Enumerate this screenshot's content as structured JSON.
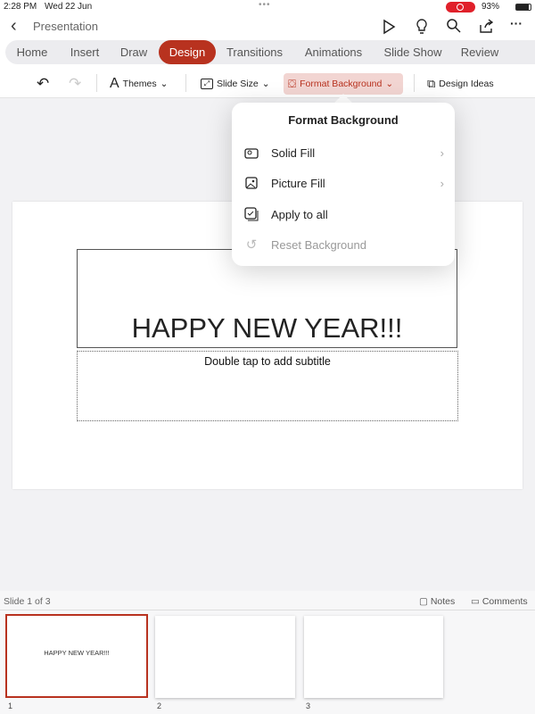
{
  "status": {
    "time": "2:28 PM",
    "date": "Wed 22 Jun",
    "battery": "93%",
    "record_color": "#e0202a"
  },
  "header": {
    "title": "Presentation"
  },
  "tabs": [
    {
      "label": "Home"
    },
    {
      "label": "Insert"
    },
    {
      "label": "Draw"
    },
    {
      "label": "Design",
      "active": true
    },
    {
      "label": "Transitions"
    },
    {
      "label": "Animations"
    },
    {
      "label": "Slide Show"
    },
    {
      "label": "Review"
    }
  ],
  "toolbar": {
    "themes": "Themes",
    "slide_size": "Slide Size",
    "format_background": "Format Background",
    "design_ideas": "Design Ideas"
  },
  "popup": {
    "title": "Format Background",
    "items": [
      {
        "label": "Solid Fill",
        "icon": "paint-bucket-icon",
        "submenu": true
      },
      {
        "label": "Picture Fill",
        "icon": "picture-icon",
        "submenu": true
      },
      {
        "label": "Apply to all",
        "icon": "apply-all-icon"
      },
      {
        "label": "Reset Background",
        "icon": "reset-icon",
        "disabled": true
      }
    ]
  },
  "slide": {
    "title": "HAPPY NEW YEAR!!!",
    "subtitle_placeholder": "Double tap to add subtitle"
  },
  "footer": {
    "slide_counter": "Slide 1 of 3",
    "notes": "Notes",
    "comments": "Comments"
  },
  "thumbnails": [
    {
      "number": "1",
      "text": "HAPPY NEW YEAR!!!",
      "selected": true
    },
    {
      "number": "2",
      "text": ""
    },
    {
      "number": "3",
      "text": ""
    }
  ],
  "accent": "#b8321f"
}
